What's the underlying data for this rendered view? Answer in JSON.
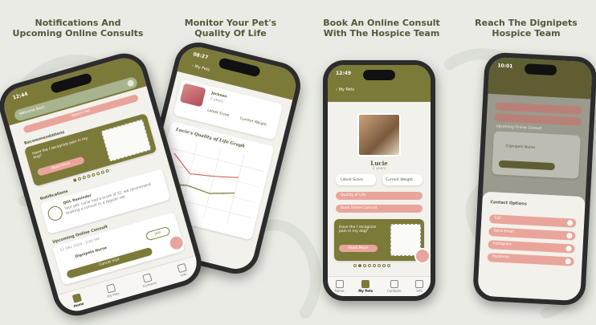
{
  "headings": {
    "col1": [
      "Notifications And",
      "Upcoming Online Consults"
    ],
    "col2": [
      "Monitor Your Pet's",
      "Quality Of Life"
    ],
    "col3": [
      "Book An Online Consult",
      "With The Hospice Team"
    ],
    "col4": [
      "Reach The Dignipets",
      "Hospice Team"
    ]
  },
  "phone1": {
    "time": "12:44",
    "greeting": "Welcome Back",
    "cta": "Search Pet",
    "recommendations": "Recommendations",
    "rec_text": "Have the I recognize pain in my dog?",
    "rec_btn": "Read More",
    "notifications": "Notifications",
    "notif_title": "QOL Reminder",
    "notif_text": "Your pet: Lucie had a score of 32, we recommend booking a consult or a regular vet.",
    "upcoming": "Upcoming Online Consult",
    "consult_date": "12 Dec 2024 · 3:00 PM",
    "vet_name": "Dignipets Nurse",
    "join": "Join",
    "cancel": "Cancel Visit",
    "tabs": [
      "Home",
      "My Pets",
      "Contacts",
      "Info"
    ]
  },
  "phone2": {
    "time": "08:27",
    "back": "My Pets",
    "pet_name": "Jackson",
    "pet_sub": "3 years",
    "stat1": "Latest Score",
    "stat2": "Current Weight",
    "graph_title": "Lucie's Quality of Life Graph"
  },
  "phone3": {
    "time": "12:49",
    "back": "My Pets",
    "pet_name": "Lucie",
    "pet_sub": "2 years",
    "stat1": "Latest Score",
    "stat2": "Current Weight",
    "btn1": "Quality of Life",
    "btn2": "Book Online Consult",
    "rec_text": "Have the I recognize pain in my dog?",
    "rec_btn": "Read More",
    "tabs": [
      "Home",
      "My Pets",
      "Contacts",
      "Info"
    ]
  },
  "phone4": {
    "time": "10:01",
    "section": "Upcoming Online Consult",
    "vet_name": "Dignipets Nurse",
    "sheet_title": "Contact Options",
    "opt1": "Call",
    "opt2": "Send Email",
    "opt3": "Instagram",
    "opt4": "Facebook"
  },
  "colors": {
    "olive": "#7c7a39",
    "pink": "#e9a59b",
    "background": "#e9ebe4",
    "heading": "#55573a"
  },
  "icons": [
    "paw-icon",
    "home-icon",
    "pets-icon",
    "contacts-icon",
    "info-icon",
    "call-icon",
    "email-icon",
    "instagram-icon",
    "facebook-icon"
  ]
}
